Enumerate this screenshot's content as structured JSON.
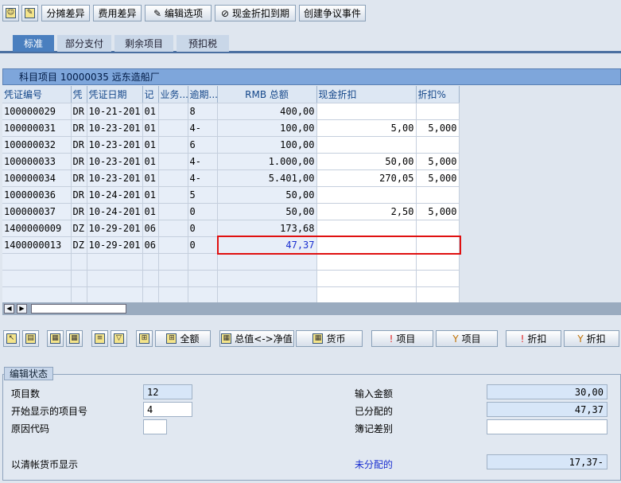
{
  "toolbar": {
    "b1": "分摊差异",
    "b2": "费用差异",
    "b3": "编辑选项",
    "b4": "现金折扣到期",
    "b5": "创建争议事件"
  },
  "tabs": [
    "标准",
    "部分支付",
    "剩余项目",
    "预扣税"
  ],
  "grid": {
    "title": "科目项目 10000035 远东造船厂",
    "headers": [
      "凭证编号",
      "凭",
      "凭证日期",
      "记",
      "业务...",
      "逾期...",
      "RMB 总额",
      "现金折扣",
      "折扣%"
    ],
    "rows": [
      [
        "100000029",
        "DR",
        "10-21-201",
        "01",
        "",
        "8",
        "400,00",
        "",
        ""
      ],
      [
        "100000031",
        "DR",
        "10-23-201",
        "01",
        "",
        "4-",
        "100,00",
        "5,00",
        "5,000"
      ],
      [
        "100000032",
        "DR",
        "10-23-201",
        "01",
        "",
        "6",
        "100,00",
        "",
        ""
      ],
      [
        "100000033",
        "DR",
        "10-23-201",
        "01",
        "",
        "4-",
        "1.000,00",
        "50,00",
        "5,000"
      ],
      [
        "100000034",
        "DR",
        "10-23-201",
        "01",
        "",
        "4-",
        "5.401,00",
        "270,05",
        "5,000"
      ],
      [
        "100000036",
        "DR",
        "10-24-201",
        "01",
        "",
        "5",
        "50,00",
        "",
        ""
      ],
      [
        "100000037",
        "DR",
        "10-24-201",
        "01",
        "",
        "0",
        "50,00",
        "2,50",
        "5,000"
      ],
      [
        "1400000009",
        "DZ",
        "10-29-201",
        "06",
        "",
        "0",
        "173,68",
        "",
        ""
      ],
      [
        "1400000013",
        "DZ",
        "10-29-201",
        "06",
        "",
        "0",
        "47,37",
        "",
        ""
      ]
    ]
  },
  "bottom_toolbar": {
    "amount": "全额",
    "gross_net": "总值<->净值",
    "currency": "货币",
    "item1": "项目",
    "item2": "项目",
    "disc1": "折扣",
    "disc2": "折扣"
  },
  "status": {
    "title": "编辑状态",
    "item_count_label": "项目数",
    "item_count": "12",
    "start_item_label": "开始显示的项目号",
    "start_item": "4",
    "reason_label": "原因代码",
    "reason": "",
    "display_label": "以清帐货币显示",
    "entered_label": "输入金额",
    "entered": "30,00",
    "assigned_label": "已分配的",
    "assigned": "47,37",
    "diff_label": "簿记差别",
    "diff": "",
    "unassigned_label": "未分配的",
    "unassigned": "17,37-"
  },
  "colors": {
    "highlight": "#e01010",
    "link": "#1a2fd0"
  }
}
